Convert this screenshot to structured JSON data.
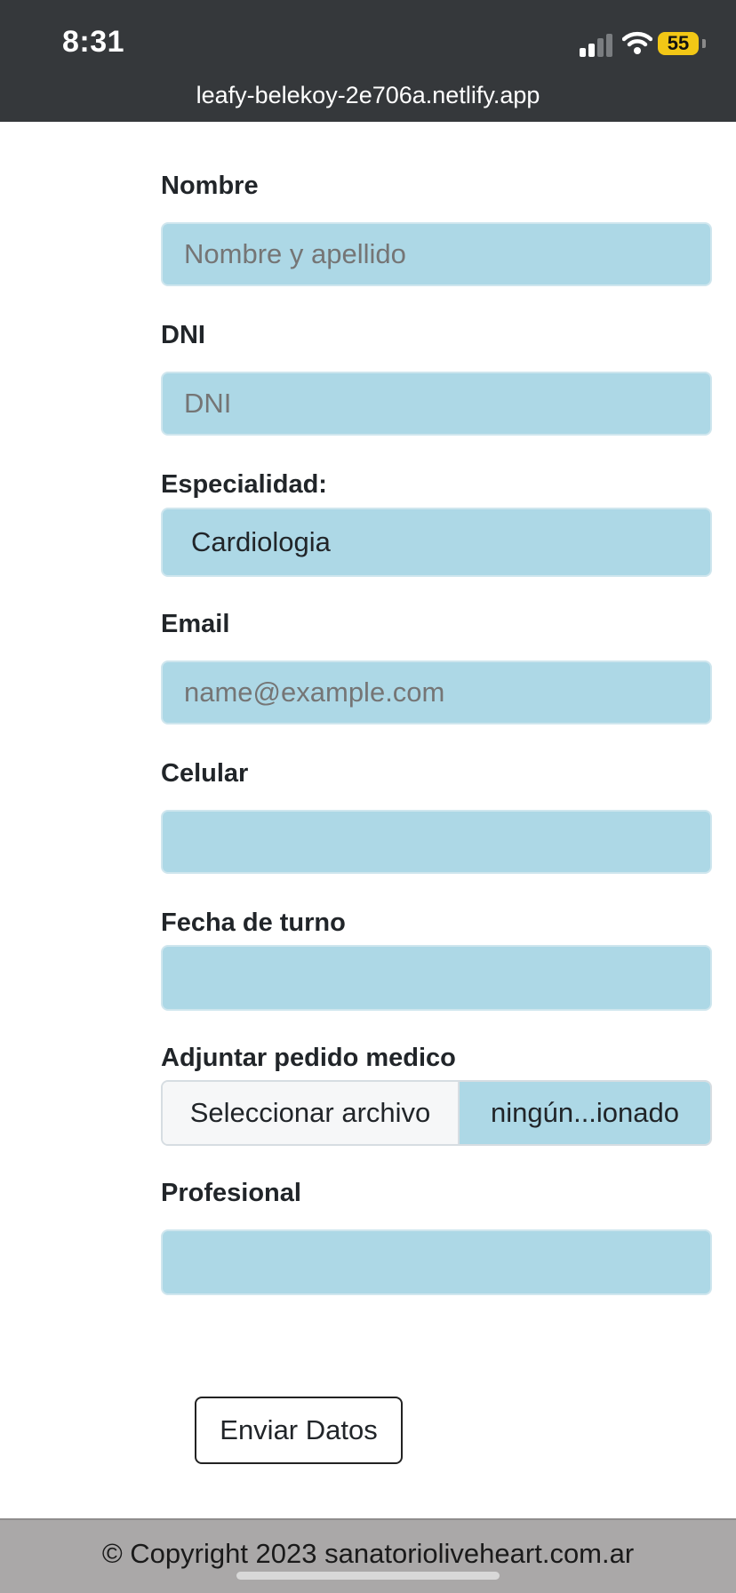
{
  "status_bar": {
    "time": "8:31",
    "battery_level": "55",
    "url": "leafy-belekoy-2e706a.netlify.app"
  },
  "form": {
    "nombre": {
      "label": "Nombre",
      "placeholder": "Nombre y apellido"
    },
    "dni": {
      "label": "DNI",
      "placeholder": "DNI"
    },
    "especialidad": {
      "label": "Especialidad:",
      "selected": "Cardiologia"
    },
    "email": {
      "label": "Email",
      "placeholder": "name@example.com"
    },
    "celular": {
      "label": "Celular",
      "value": ""
    },
    "fecha": {
      "label": "Fecha de turno",
      "value": ""
    },
    "adjuntar": {
      "label": "Adjuntar pedido medico",
      "button_label": "Seleccionar archivo",
      "file_status": "ningún...ionado"
    },
    "profesional": {
      "label": "Profesional",
      "value": ""
    },
    "submit_label": "Enviar Datos"
  },
  "footer": {
    "text": "© Copyright 2023 sanatorioliveheart.com.ar"
  },
  "colors": {
    "status_bar_bg": "#35383b",
    "input_bg": "#add8e6",
    "footer_bg": "#aaa8a8",
    "battery": "#f2c716"
  }
}
